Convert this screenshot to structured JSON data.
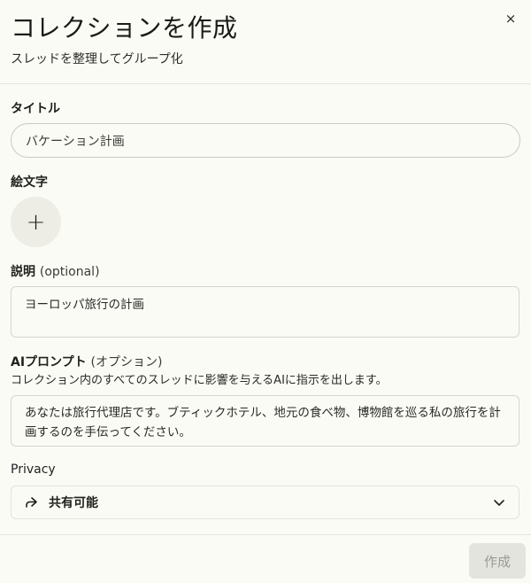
{
  "dialog": {
    "title": "コレクションを作成",
    "subtitle": "スレッドを整理してグループ化",
    "close_label": "×"
  },
  "fields": {
    "title_label": "タイトル",
    "title_value": "バケーション計画",
    "emoji_label": "絵文字",
    "emoji_button": "+",
    "description_label": "説明",
    "description_optional": "(optional)",
    "description_value": "ヨーロッパ旅行の計画",
    "ai_prompt_label": "AIプロンプト",
    "ai_prompt_optional": "(オプション)",
    "ai_prompt_help": "コレクション内のすべてのスレッドに影響を与えるAIに指示を出します。",
    "ai_prompt_value": "あなたは旅行代理店です。ブティックホテル、地元の食べ物、博物館を巡る私の旅行を計画するのを手伝ってください。",
    "privacy_label": "Privacy",
    "privacy_value": "共有可能",
    "privacy_icon": "share-arrow-icon"
  },
  "footer": {
    "create_label": "作成"
  },
  "colors": {
    "background": "#fbfbf6",
    "create_disabled_bg": "#e4e4de",
    "create_disabled_text": "#9a9a94"
  }
}
